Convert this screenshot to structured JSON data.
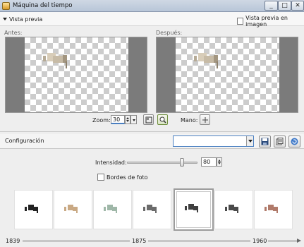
{
  "window": {
    "title": "Máquina del tiempo"
  },
  "preview": {
    "section_label": "Vista previa",
    "show_in_image_label": "Vista previa en imagen",
    "before_label": "Antes:",
    "after_label": "Después:"
  },
  "zoom": {
    "label": "Zoom:",
    "value": "30",
    "pan_label": "Mano:"
  },
  "config": {
    "label": "Configuración",
    "combo_value": ""
  },
  "intensity": {
    "label": "Intensidad:",
    "value": "80",
    "level": 80
  },
  "photo_borders": {
    "label": "Bordes de foto",
    "checked": false
  },
  "presets": {
    "selected_index": 4,
    "items": [
      {
        "tone": "#222222"
      },
      {
        "tone": "#c9a984"
      },
      {
        "tone": "#9fb7a8"
      },
      {
        "tone": "#6b6b6b"
      },
      {
        "tone": "#3f3f3f"
      },
      {
        "tone": "#4a4a4a"
      },
      {
        "tone": "#b07a6a"
      }
    ]
  },
  "timeline": {
    "start": "1839",
    "middle": "1875",
    "end": "1960"
  },
  "colors": {
    "accent": "#4a7fc1",
    "pane_bg": "#7b7b7b"
  }
}
